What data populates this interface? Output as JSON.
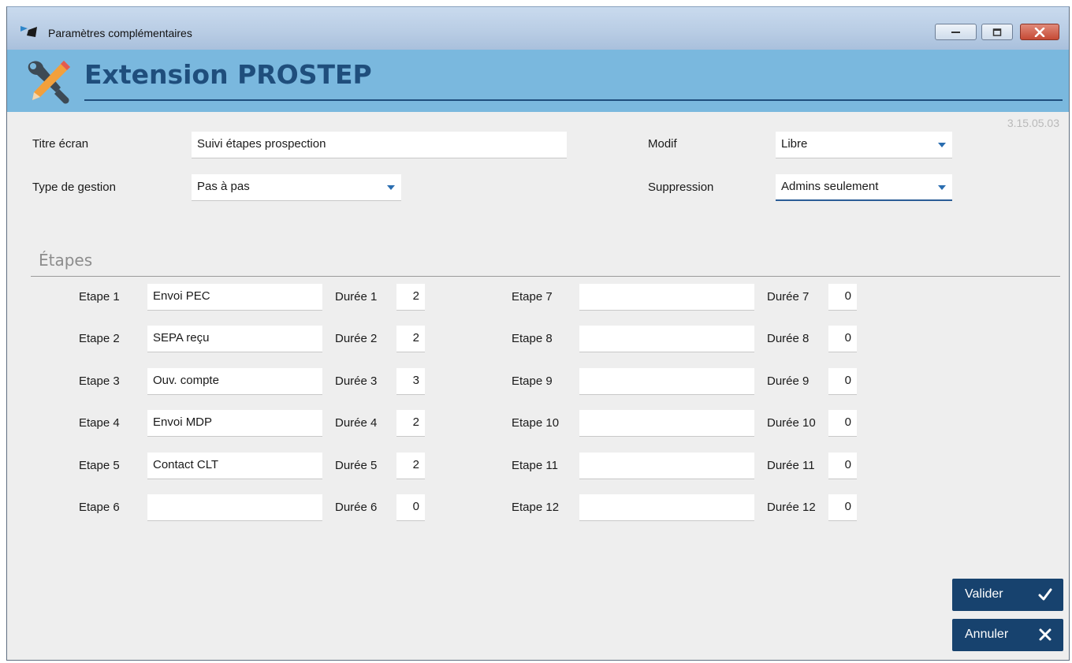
{
  "window": {
    "title": "Paramètres complémentaires"
  },
  "banner": {
    "title": "Extension PROSTEP",
    "version": "3.15.05.03"
  },
  "form": {
    "titre_ecran": {
      "label": "Titre écran",
      "value": "Suivi étapes prospection"
    },
    "type_gestion": {
      "label": "Type de gestion",
      "value": "Pas à pas"
    },
    "modif": {
      "label": "Modif",
      "value": "Libre"
    },
    "suppression": {
      "label": "Suppression",
      "value": "Admins seulement"
    }
  },
  "section": {
    "title": "Étapes"
  },
  "steps": [
    {
      "label": "Etape 1",
      "value": "Envoi PEC",
      "duree_label": "Durée 1",
      "duree": "2"
    },
    {
      "label": "Etape 2",
      "value": "SEPA reçu",
      "duree_label": "Durée 2",
      "duree": "2"
    },
    {
      "label": "Etape 3",
      "value": "Ouv. compte",
      "duree_label": "Durée 3",
      "duree": "3"
    },
    {
      "label": "Etape 4",
      "value": "Envoi MDP",
      "duree_label": "Durée 4",
      "duree": "2"
    },
    {
      "label": "Etape 5",
      "value": "Contact CLT",
      "duree_label": "Durée 5",
      "duree": "2"
    },
    {
      "label": "Etape 6",
      "value": "",
      "duree_label": "Durée 6",
      "duree": "0"
    },
    {
      "label": "Etape 7",
      "value": "",
      "duree_label": "Durée 7",
      "duree": "0"
    },
    {
      "label": "Etape 8",
      "value": "",
      "duree_label": "Durée 8",
      "duree": "0"
    },
    {
      "label": "Etape 9",
      "value": "",
      "duree_label": "Durée 9",
      "duree": "0"
    },
    {
      "label": "Etape 10",
      "value": "",
      "duree_label": "Durée 10",
      "duree": "0"
    },
    {
      "label": "Etape 11",
      "value": "",
      "duree_label": "Durée 11",
      "duree": "0"
    },
    {
      "label": "Etape 12",
      "value": "",
      "duree_label": "Durée 12",
      "duree": "0"
    }
  ],
  "buttons": {
    "valider": "Valider",
    "annuler": "Annuler"
  },
  "colors": {
    "banner": "#7ab8de",
    "banner_text": "#1f4e7c",
    "button": "#17426e"
  }
}
